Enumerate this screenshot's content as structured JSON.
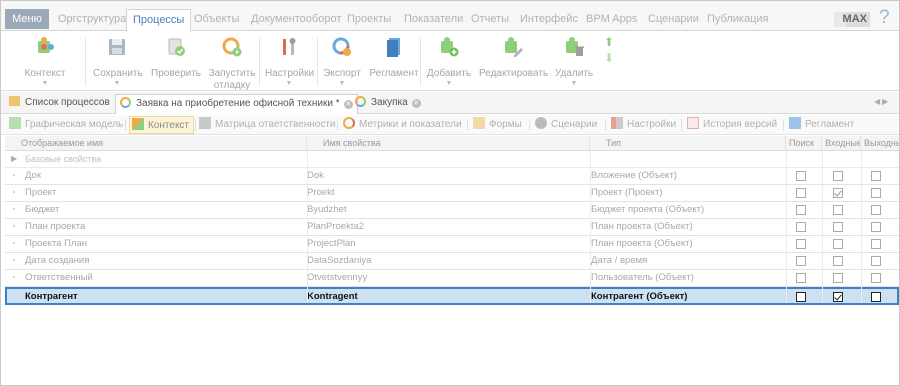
{
  "menubar": {
    "menu_button": "Меню",
    "tabs": [
      "Оргструктура",
      "Процессы",
      "Объекты",
      "Документооборот",
      "Проекты",
      "Показатели",
      "Отчеты",
      "Интерфейс",
      "BPM Apps",
      "Сценарии",
      "Публикация"
    ],
    "active_tab": "Процессы",
    "max_badge": "MAX",
    "help": "?"
  },
  "ribbon": {
    "buttons": [
      {
        "label": "Контекст",
        "icon": "puzzle-gear-icon",
        "caret": true
      },
      {
        "label": "Сохранить",
        "icon": "save-icon",
        "caret": true
      },
      {
        "label": "Проверить",
        "icon": "check-icon",
        "caret": false
      },
      {
        "label": "Запустить отладку",
        "icon": "run-debug-icon",
        "caret": false
      },
      {
        "label": "Настройки",
        "icon": "tools-icon",
        "caret": true
      },
      {
        "label": "Экспорт",
        "icon": "export-icon",
        "caret": true
      },
      {
        "label": "Регламент",
        "icon": "book-icon",
        "caret": false
      },
      {
        "label": "Добавить",
        "icon": "puzzle-add-icon",
        "caret": true
      },
      {
        "label": "Редактировать",
        "icon": "puzzle-edit-icon",
        "caret": false
      },
      {
        "label": "Удалить",
        "icon": "puzzle-delete-icon",
        "caret": true
      }
    ],
    "move_up_icon": "arrow-up-icon",
    "move_down_icon": "arrow-down-icon"
  },
  "doctabs": {
    "tabs": [
      {
        "label": "Список процессов"
      },
      {
        "label": "Заявка на приобретение офисной техники *"
      },
      {
        "label": "Закупка"
      }
    ]
  },
  "subtabs": {
    "tabs": [
      "Графическая модель",
      "Контекст",
      "Матрица ответственности",
      "Метрики и показатели",
      "Формы",
      "Сценарии",
      "Настройки",
      "История версий",
      "Регламент"
    ],
    "active": "Контекст"
  },
  "table": {
    "columns": [
      "Отображаемое имя",
      "Имя свойства",
      "Тип",
      "Поиск",
      "Входные",
      "Выходные"
    ],
    "group": "Базовые свойства",
    "rows": [
      {
        "display": "Док",
        "prop": "Dok",
        "type": "Вложение (Объект)",
        "search": false,
        "input": false,
        "output": false
      },
      {
        "display": "Проект",
        "prop": "Proekt",
        "type": "Проект (Проект)",
        "search": false,
        "input": true,
        "output": false
      },
      {
        "display": "Бюджет",
        "prop": "Byudzhet",
        "type": "Бюджет проекта (Объект)",
        "search": false,
        "input": false,
        "output": false
      },
      {
        "display": "План проекта",
        "prop": "PlanProekta2",
        "type": "План проекта (Объект)",
        "search": false,
        "input": false,
        "output": false
      },
      {
        "display": "Проекта План",
        "prop": "ProjectPlan",
        "type": "План проекта (Объект)",
        "search": false,
        "input": false,
        "output": false
      },
      {
        "display": "Дата создания",
        "prop": "DataSozdaniya",
        "type": "Дата / время",
        "search": false,
        "input": false,
        "output": false
      },
      {
        "display": "Ответственный",
        "prop": "Otvetstvennyy",
        "type": "Пользователь (Объект)",
        "search": false,
        "input": false,
        "output": false
      },
      {
        "display": "Контрагент",
        "prop": "Kontragent",
        "type": "Контрагент (Объект)",
        "search": false,
        "input": true,
        "output": false,
        "selected": true
      }
    ]
  },
  "colors": {
    "accent": "#3d82c7",
    "selection": "#cde1f3",
    "active_subtab": "#fdf3d6"
  }
}
